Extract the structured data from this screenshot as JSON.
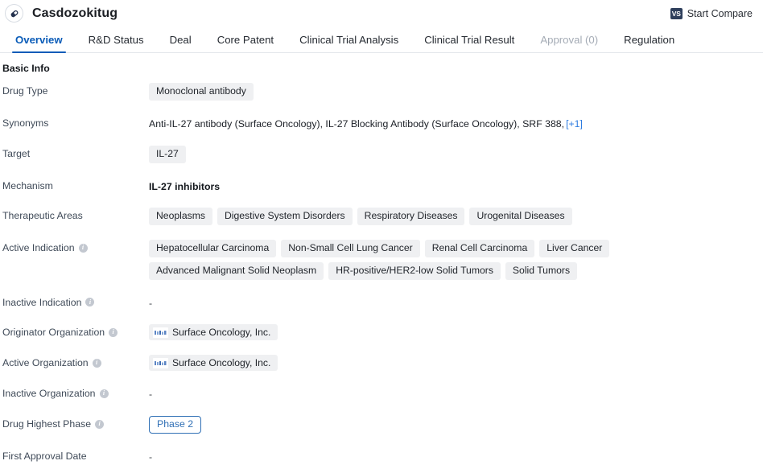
{
  "header": {
    "drug_icon": "pill-capsule-icon",
    "title": "Casdozokitug",
    "compare": {
      "icon_label": "VS",
      "label": "Start Compare"
    }
  },
  "tabs": [
    {
      "label": "Overview",
      "state": "active"
    },
    {
      "label": "R&D Status",
      "state": "normal"
    },
    {
      "label": "Deal",
      "state": "normal"
    },
    {
      "label": "Core Patent",
      "state": "normal"
    },
    {
      "label": "Clinical Trial Analysis",
      "state": "normal"
    },
    {
      "label": "Clinical Trial Result",
      "state": "normal"
    },
    {
      "label": "Approval (0)",
      "state": "disabled"
    },
    {
      "label": "Regulation",
      "state": "normal"
    }
  ],
  "section": {
    "title": "Basic Info"
  },
  "rows": {
    "drug_type": {
      "label": "Drug Type",
      "tags": [
        "Monoclonal antibody"
      ]
    },
    "synonyms": {
      "label": "Synonyms",
      "text": "Anti-IL-27 antibody (Surface Oncology),  IL-27 Blocking Antibody (Surface Oncology),  SRF 388,",
      "more": "[+1]"
    },
    "target": {
      "label": "Target",
      "tags": [
        "IL-27"
      ]
    },
    "mechanism": {
      "label": "Mechanism",
      "value": "IL-27 inhibitors"
    },
    "therapeutic_areas": {
      "label": "Therapeutic Areas",
      "tags": [
        "Neoplasms",
        "Digestive System Disorders",
        "Respiratory Diseases",
        "Urogenital Diseases"
      ]
    },
    "active_indication": {
      "label": "Active Indication",
      "has_info": true,
      "tags": [
        "Hepatocellular Carcinoma",
        "Non-Small Cell Lung Cancer",
        "Renal Cell Carcinoma",
        "Liver Cancer",
        "Advanced Malignant Solid Neoplasm",
        "HR-positive/HER2-low Solid Tumors",
        "Solid Tumors"
      ]
    },
    "inactive_indication": {
      "label": "Inactive Indication",
      "has_info": true,
      "value": "-"
    },
    "originator_organization": {
      "label": "Originator Organization",
      "has_info": true,
      "org": "Surface Oncology, Inc."
    },
    "active_organization": {
      "label": "Active Organization",
      "has_info": true,
      "org": "Surface Oncology, Inc."
    },
    "inactive_organization": {
      "label": "Inactive Organization",
      "has_info": true,
      "value": "-"
    },
    "drug_highest_phase": {
      "label": "Drug Highest Phase",
      "has_info": true,
      "badge": "Phase 2"
    },
    "first_approval_date": {
      "label": "First Approval Date",
      "value": "-"
    }
  },
  "colors": {
    "accent_blue": "#0a5cb8",
    "link_blue": "#2e7ce0",
    "phase_blue": "#2f6fb5",
    "tag_bg": "#eff0f2",
    "label_text": "#3f4a58",
    "vs_badge": "#2e3f5c"
  }
}
